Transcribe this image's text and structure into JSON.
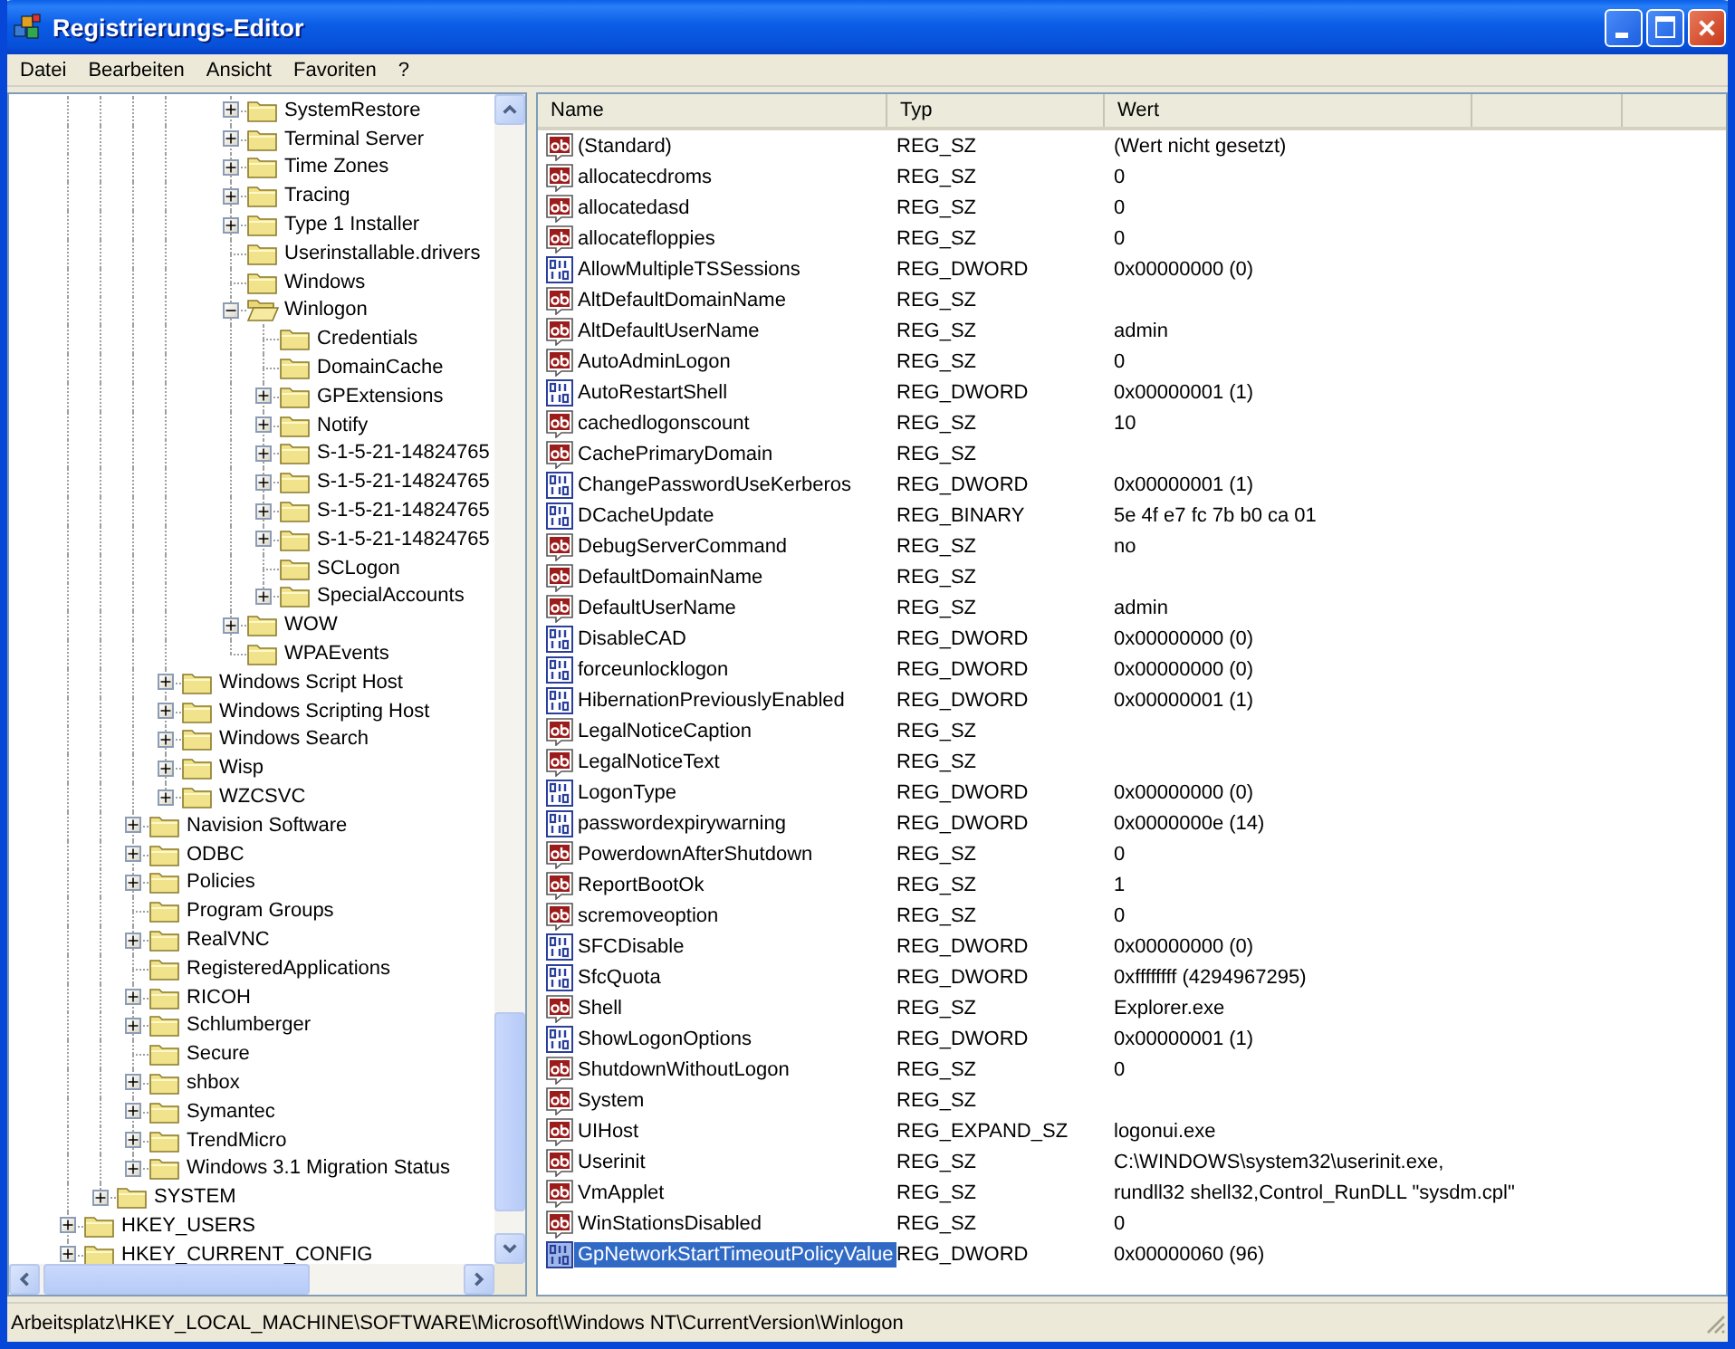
{
  "window": {
    "title": "Registrierungs-Editor"
  },
  "menu": [
    "Datei",
    "Bearbeiten",
    "Ansicht",
    "Favoriten",
    "?"
  ],
  "tree": [
    {
      "children": [
        {
          "children": [
            {
              "children": [
                {
                  "children": [
                    {
                      "children": [
                        {
                          "children": [
                            {
                              "label": "SystemRestore",
                              "expanded": false,
                              "selected": false
                            },
                            {
                              "label": "Terminal Server",
                              "expanded": false,
                              "selected": false
                            },
                            {
                              "label": "Time Zones",
                              "expanded": false,
                              "selected": false
                            },
                            {
                              "label": "Tracing",
                              "expanded": false,
                              "selected": false
                            },
                            {
                              "label": "Type 1 Installer",
                              "expanded": false,
                              "selected": false
                            },
                            {
                              "label": "Userinstallable.drivers",
                              "selected": false
                            },
                            {
                              "label": "Windows",
                              "selected": false
                            },
                            {
                              "label": "Winlogon",
                              "expanded": true,
                              "selected": true,
                              "children": [
                                {
                                  "label": "Credentials",
                                  "selected": false
                                },
                                {
                                  "label": "DomainCache",
                                  "selected": false
                                },
                                {
                                  "label": "GPExtensions",
                                  "expanded": false,
                                  "selected": false
                                },
                                {
                                  "label": "Notify",
                                  "expanded": false,
                                  "selected": false
                                },
                                {
                                  "label": "S-1-5-21-14824765",
                                  "expanded": false,
                                  "selected": false
                                },
                                {
                                  "label": "S-1-5-21-14824765",
                                  "expanded": false,
                                  "selected": false
                                },
                                {
                                  "label": "S-1-5-21-14824765",
                                  "expanded": false,
                                  "selected": false
                                },
                                {
                                  "label": "S-1-5-21-14824765",
                                  "expanded": false,
                                  "selected": false
                                },
                                {
                                  "label": "SCLogon",
                                  "selected": false
                                },
                                {
                                  "label": "SpecialAccounts",
                                  "expanded": false,
                                  "selected": false
                                }
                              ]
                            },
                            {
                              "label": "WOW",
                              "expanded": false,
                              "selected": false
                            },
                            {
                              "label": "WPAEvents",
                              "selected": false
                            }
                          ]
                        }
                      ]
                    },
                    {
                      "label": "Windows Script Host",
                      "expanded": false,
                      "selected": false
                    },
                    {
                      "label": "Windows Scripting Host",
                      "expanded": false,
                      "selected": false
                    },
                    {
                      "label": "Windows Search",
                      "expanded": false,
                      "selected": false
                    },
                    {
                      "label": "Wisp",
                      "expanded": false,
                      "selected": false
                    },
                    {
                      "label": "WZCSVC",
                      "expanded": false,
                      "selected": false
                    }
                  ]
                },
                {
                  "label": "Navision Software",
                  "expanded": false,
                  "selected": false
                },
                {
                  "label": "ODBC",
                  "expanded": false,
                  "selected": false
                },
                {
                  "label": "Policies",
                  "expanded": false,
                  "selected": false
                },
                {
                  "label": "Program Groups",
                  "selected": false
                },
                {
                  "label": "RealVNC",
                  "expanded": false,
                  "selected": false
                },
                {
                  "label": "RegisteredApplications",
                  "selected": false
                },
                {
                  "label": "RICOH",
                  "expanded": false,
                  "selected": false
                },
                {
                  "label": "Schlumberger",
                  "expanded": false,
                  "selected": false
                },
                {
                  "label": "Secure",
                  "selected": false
                },
                {
                  "label": "shbox",
                  "expanded": false,
                  "selected": false
                },
                {
                  "label": "Symantec",
                  "expanded": false,
                  "selected": false
                },
                {
                  "label": "TrendMicro",
                  "expanded": false,
                  "selected": false
                },
                {
                  "label": "Windows 3.1 Migration Status",
                  "expanded": false,
                  "selected": false
                }
              ]
            },
            {
              "label": "SYSTEM",
              "expanded": false,
              "selected": false
            }
          ]
        },
        {
          "label": "HKEY_USERS",
          "expanded": false,
          "selected": false
        },
        {
          "label": "HKEY_CURRENT_CONFIG",
          "expanded": false,
          "selected": false
        }
      ]
    }
  ],
  "list": {
    "columns": [
      "Name",
      "Typ",
      "Wert"
    ],
    "rows": [
      {
        "kind": "string",
        "name": "(Standard)",
        "type": "REG_SZ",
        "value": "(Wert nicht gesetzt)",
        "selected": false
      },
      {
        "kind": "string",
        "name": "allocatecdroms",
        "type": "REG_SZ",
        "value": "0",
        "selected": false
      },
      {
        "kind": "string",
        "name": "allocatedasd",
        "type": "REG_SZ",
        "value": "0",
        "selected": false
      },
      {
        "kind": "string",
        "name": "allocatefloppies",
        "type": "REG_SZ",
        "value": "0",
        "selected": false
      },
      {
        "kind": "binary",
        "name": "AllowMultipleTSSessions",
        "type": "REG_DWORD",
        "value": "0x00000000 (0)",
        "selected": false
      },
      {
        "kind": "string",
        "name": "AltDefaultDomainName",
        "type": "REG_SZ",
        "selected": false
      },
      {
        "kind": "string",
        "name": "AltDefaultUserName",
        "type": "REG_SZ",
        "value": "admin",
        "selected": false
      },
      {
        "kind": "string",
        "name": "AutoAdminLogon",
        "type": "REG_SZ",
        "value": "0",
        "selected": false
      },
      {
        "kind": "binary",
        "name": "AutoRestartShell",
        "type": "REG_DWORD",
        "value": "0x00000001 (1)",
        "selected": false
      },
      {
        "kind": "string",
        "name": "cachedlogonscount",
        "type": "REG_SZ",
        "value": "10",
        "selected": false
      },
      {
        "kind": "string",
        "name": "CachePrimaryDomain",
        "type": "REG_SZ",
        "selected": false
      },
      {
        "kind": "binary",
        "name": "ChangePasswordUseKerberos",
        "type": "REG_DWORD",
        "value": "0x00000001 (1)",
        "selected": false
      },
      {
        "kind": "binary",
        "name": "DCacheUpdate",
        "type": "REG_BINARY",
        "value": "5e 4f e7 fc 7b b0 ca 01",
        "selected": false
      },
      {
        "kind": "string",
        "name": "DebugServerCommand",
        "type": "REG_SZ",
        "value": "no",
        "selected": false
      },
      {
        "kind": "string",
        "name": "DefaultDomainName",
        "type": "REG_SZ",
        "selected": false
      },
      {
        "kind": "string",
        "name": "DefaultUserName",
        "type": "REG_SZ",
        "value": "admin",
        "selected": false
      },
      {
        "kind": "binary",
        "name": "DisableCAD",
        "type": "REG_DWORD",
        "value": "0x00000000 (0)",
        "selected": false
      },
      {
        "kind": "binary",
        "name": "forceunlocklogon",
        "type": "REG_DWORD",
        "value": "0x00000000 (0)",
        "selected": false
      },
      {
        "kind": "binary",
        "name": "HibernationPreviouslyEnabled",
        "type": "REG_DWORD",
        "value": "0x00000001 (1)",
        "selected": false
      },
      {
        "kind": "string",
        "name": "LegalNoticeCaption",
        "type": "REG_SZ",
        "selected": false
      },
      {
        "kind": "string",
        "name": "LegalNoticeText",
        "type": "REG_SZ",
        "selected": false
      },
      {
        "kind": "binary",
        "name": "LogonType",
        "type": "REG_DWORD",
        "value": "0x00000000 (0)",
        "selected": false
      },
      {
        "kind": "binary",
        "name": "passwordexpirywarning",
        "type": "REG_DWORD",
        "value": "0x0000000e (14)",
        "selected": false
      },
      {
        "kind": "string",
        "name": "PowerdownAfterShutdown",
        "type": "REG_SZ",
        "value": "0",
        "selected": false
      },
      {
        "kind": "string",
        "name": "ReportBootOk",
        "type": "REG_SZ",
        "value": "1",
        "selected": false
      },
      {
        "kind": "string",
        "name": "scremoveoption",
        "type": "REG_SZ",
        "value": "0",
        "selected": false
      },
      {
        "kind": "binary",
        "name": "SFCDisable",
        "type": "REG_DWORD",
        "value": "0x00000000 (0)",
        "selected": false
      },
      {
        "kind": "binary",
        "name": "SfcQuota",
        "type": "REG_DWORD",
        "value": "0xffffffff (4294967295)",
        "selected": false
      },
      {
        "kind": "string",
        "name": "Shell",
        "type": "REG_SZ",
        "value": "Explorer.exe",
        "selected": false
      },
      {
        "kind": "binary",
        "name": "ShowLogonOptions",
        "type": "REG_DWORD",
        "value": "0x00000001 (1)",
        "selected": false
      },
      {
        "kind": "string",
        "name": "ShutdownWithoutLogon",
        "type": "REG_SZ",
        "value": "0",
        "selected": false
      },
      {
        "kind": "string",
        "name": "System",
        "type": "REG_SZ",
        "selected": false
      },
      {
        "kind": "string",
        "name": "UIHost",
        "type": "REG_EXPAND_SZ",
        "value": "logonui.exe",
        "selected": false
      },
      {
        "kind": "string",
        "name": "Userinit",
        "type": "REG_SZ",
        "value": "C:\\WINDOWS\\system32\\userinit.exe,",
        "selected": false
      },
      {
        "kind": "string",
        "name": "VmApplet",
        "type": "REG_SZ",
        "value": "rundll32 shell32,Control_RunDLL \"sysdm.cpl\"",
        "selected": false
      },
      {
        "kind": "string",
        "name": "WinStationsDisabled",
        "type": "REG_SZ",
        "value": "0",
        "selected": false
      },
      {
        "kind": "binary",
        "name": "GpNetworkStartTimeoutPolicyValue",
        "type": "REG_DWORD",
        "value": "0x00000060 (96)",
        "selected": true
      }
    ]
  },
  "status_bar": "Arbeitsplatz\\HKEY_LOCAL_MACHINE\\SOFTWARE\\Microsoft\\Windows NT\\CurrentVersion\\Winlogon"
}
